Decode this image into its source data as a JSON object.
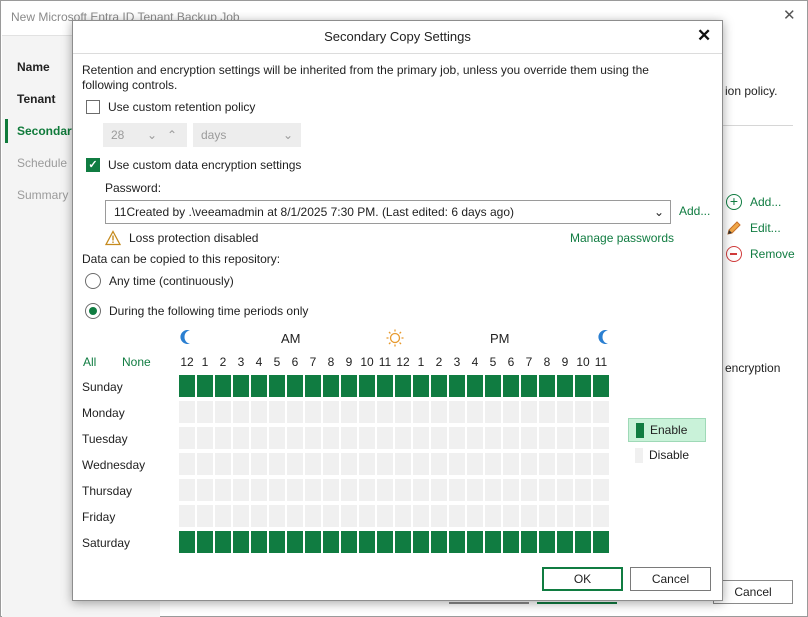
{
  "background_window": {
    "title": "New Microsoft Entra ID Tenant Backup Job",
    "steps": [
      "Name",
      "Tenant",
      "Secondary",
      "Schedule",
      "Summary"
    ],
    "right_text_top": "ion policy.",
    "actions": [
      "Add...",
      "Edit...",
      "Remove"
    ],
    "right_text_mid": "encryption",
    "cancel_label": "Cancel"
  },
  "dialog": {
    "title": "Secondary Copy Settings",
    "intro": "Retention and encryption settings will be inherited from the primary job, unless you override them using the following controls.",
    "custom_retention": {
      "label": "Use custom retention policy",
      "checked": false,
      "value": "28",
      "unit": "days"
    },
    "custom_encryption": {
      "label": "Use custom data encryption settings",
      "checked": true,
      "password_label": "Password:",
      "password_value": "11Created by .\\veeamadmin at 8/1/2025 7:30 PM. (Last edited: 6 days ago)",
      "add_link": "Add...",
      "warning": "Loss protection disabled",
      "manage_link": "Manage passwords"
    },
    "copy_label": "Data can be copied to this repository:",
    "radio_any": "Any time (continuously)",
    "radio_periods": "During the following time periods only",
    "selected_radio": "periods",
    "schedule": {
      "am_label": "AM",
      "pm_label": "PM",
      "all_label": "All",
      "none_label": "None",
      "hours": [
        "12",
        "1",
        "2",
        "3",
        "4",
        "5",
        "6",
        "7",
        "8",
        "9",
        "10",
        "11",
        "12",
        "1",
        "2",
        "3",
        "4",
        "5",
        "6",
        "7",
        "8",
        "9",
        "10",
        "11"
      ],
      "days": [
        {
          "name": "Sunday",
          "enabled": true
        },
        {
          "name": "Monday",
          "enabled": false
        },
        {
          "name": "Tuesday",
          "enabled": false
        },
        {
          "name": "Wednesday",
          "enabled": false
        },
        {
          "name": "Thursday",
          "enabled": false
        },
        {
          "name": "Friday",
          "enabled": false
        },
        {
          "name": "Saturday",
          "enabled": true
        }
      ],
      "legend_enable": "Enable",
      "legend_disable": "Disable",
      "enabled_color": "#107c41",
      "disabled_color": "#f0f0f0"
    },
    "ok_label": "OK",
    "cancel_label": "Cancel"
  }
}
